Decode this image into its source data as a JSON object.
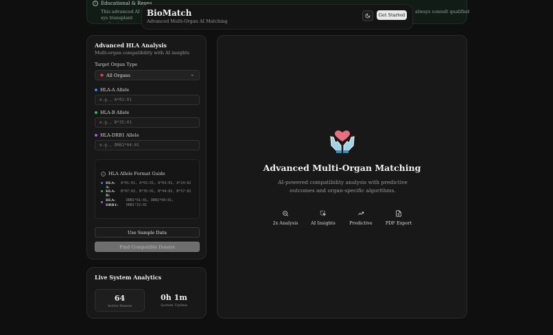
{
  "disclaimer": {
    "title": "Educational & Resea",
    "text": "This advanced AI sys transplant professio",
    "tail": "always consult qualified"
  },
  "header": {
    "brand": "BioMatch",
    "tagline": "Advanced Multi-Organ AI Matching",
    "theme_icon": "moon-icon",
    "cta_label": "Get Started"
  },
  "form": {
    "title": "Advanced HLA Analysis",
    "subtitle": "Multi-organ compatibility with AI insights",
    "organ_label": "Target Organ Type",
    "organ_value": "All Organs",
    "organ_icon": "heart-icon",
    "fields": [
      {
        "label": "HLA-A Allele",
        "placeholder": "e.g., A*02:01",
        "color": "#3b82f6"
      },
      {
        "label": "HLA-B Allele",
        "placeholder": "e.g., B*35:01",
        "color": "#22c55e"
      },
      {
        "label": "HLA-DRB1 Allele",
        "placeholder": "e.g., DRB1*04:01",
        "color": "#a855f7"
      }
    ],
    "guide": {
      "title": "HLA Allele Format Guide",
      "rows": [
        {
          "key": "HLA-A:",
          "value": "A*01:01, A*02:01, A*03:01, A*24:02",
          "color": "#3b82f6"
        },
        {
          "key": "HLA-B:",
          "value": "B*07:02, B*35:01, B*44:02, B*57:01",
          "color": "#22c55e"
        },
        {
          "key": "HLA-DRB1:",
          "value": "DRB1*01:01, DRB1*04:01, DRB1*15:01",
          "color": "#a855f7"
        }
      ]
    },
    "sample_button": "Use Sample Data",
    "find_button": "Find Compatible Donors"
  },
  "analytics": {
    "title": "Live System Analytics",
    "stats": [
      {
        "value": "64",
        "label": "Active Donors"
      },
      {
        "value": "0h 1m",
        "label": "System Uptime"
      }
    ]
  },
  "hero": {
    "title": "Advanced Multi-Organ Matching",
    "description": "AI-powered compatibility analysis with predictive outcomes and organ-specific algorithms.",
    "features": [
      {
        "label": "2x Analysis",
        "icon": "search-icon"
      },
      {
        "label": "AI Insights",
        "icon": "pointer-icon"
      },
      {
        "label": "Predictive",
        "icon": "trend-icon"
      },
      {
        "label": "PDF Export",
        "icon": "file-icon"
      }
    ]
  }
}
